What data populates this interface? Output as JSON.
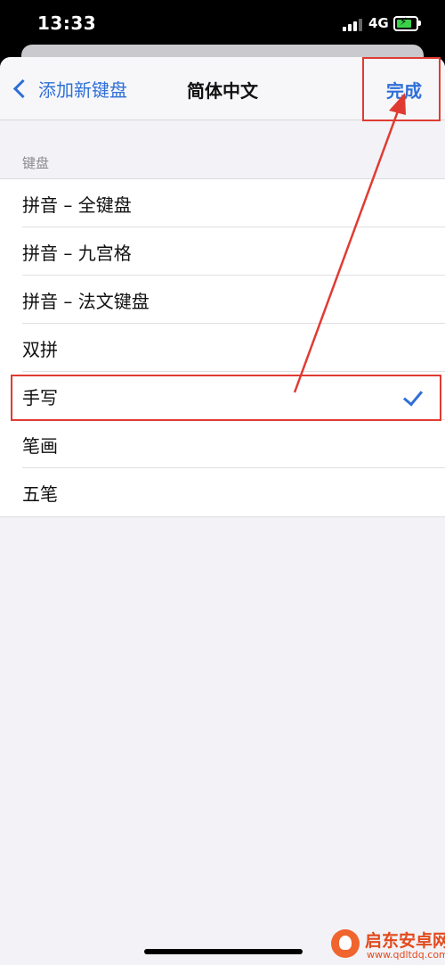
{
  "status_bar": {
    "time": "13:33",
    "network": "4G"
  },
  "nav": {
    "back_label": "添加新键盘",
    "title": "简体中文",
    "done_label": "完成"
  },
  "section": {
    "header": "键盘"
  },
  "keyboards": [
    {
      "label": "拼音 – 全键盘",
      "checked": false
    },
    {
      "label": "拼音 – 九宫格",
      "checked": false
    },
    {
      "label": "拼音 – 法文键盘",
      "checked": false
    },
    {
      "label": "双拼",
      "checked": false
    },
    {
      "label": "手写",
      "checked": true
    },
    {
      "label": "笔画",
      "checked": false
    },
    {
      "label": "五笔",
      "checked": false
    }
  ],
  "colors": {
    "accent": "#2f6fd7",
    "annotation": "#e03b33",
    "battery": "#3ad14a"
  },
  "watermark": {
    "title": "启东安卓网",
    "url": "www.qdltdq.com"
  }
}
